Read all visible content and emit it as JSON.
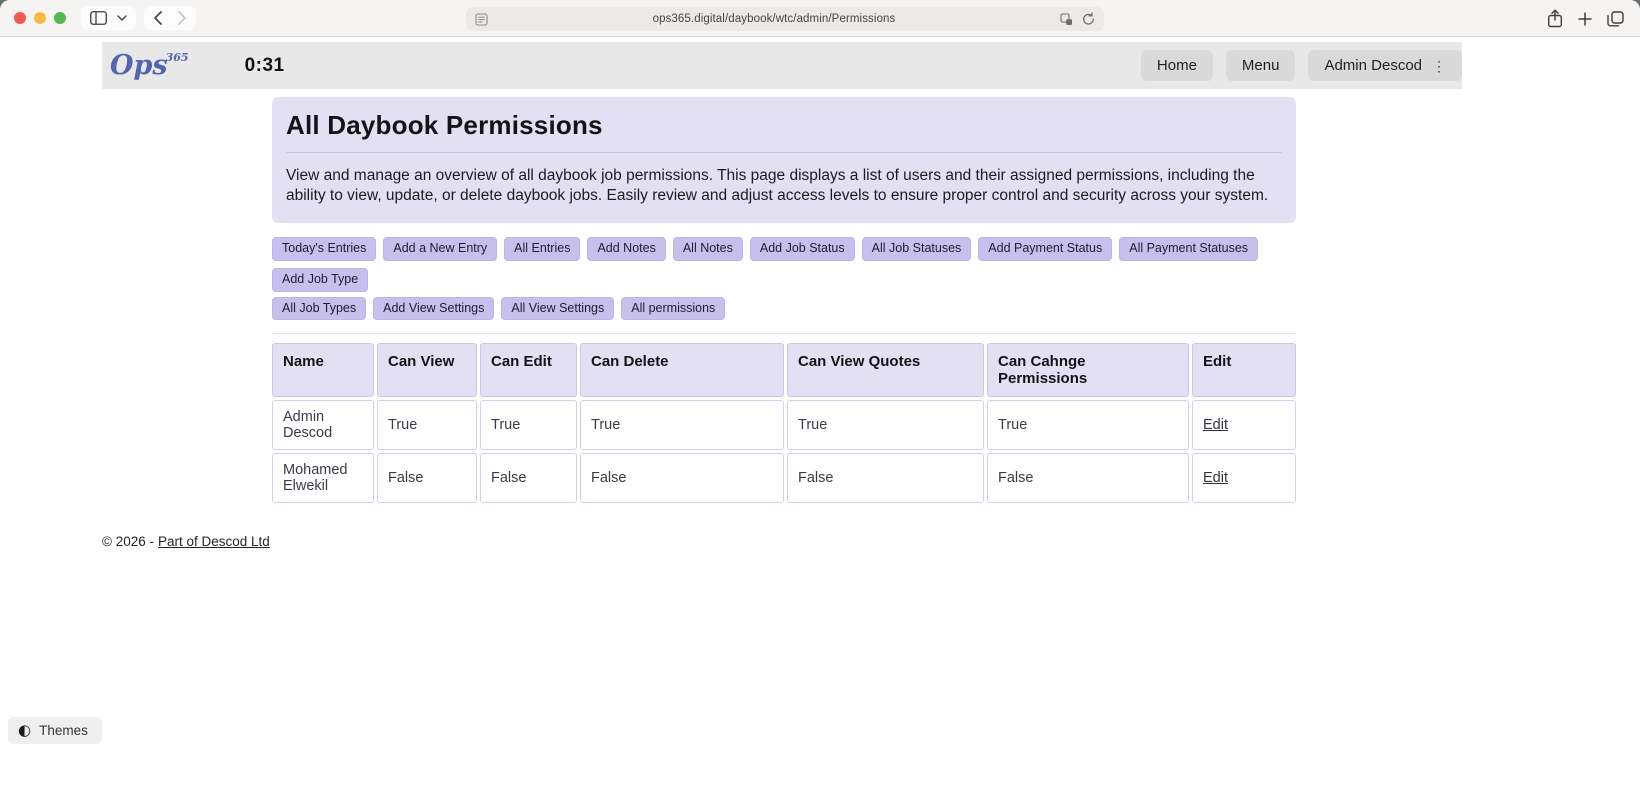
{
  "browser": {
    "url": "ops365.digital/daybook/wtc/admin/Permissions"
  },
  "site_header": {
    "logo_text": "Ops",
    "logo_superscript": "365",
    "timer": "0:31",
    "nav": [
      {
        "label": "Home"
      },
      {
        "label": "Menu"
      },
      {
        "label": "Admin Descod"
      }
    ]
  },
  "jumbotron": {
    "title": "All Daybook Permissions",
    "description": "View and manage an overview of all daybook job permissions. This page displays a list of users and their assigned permissions, including the ability to view, update, or delete daybook jobs. Easily review and adjust access levels to ensure proper control and security across your system."
  },
  "quick_links": {
    "row1": [
      "Today's Entries",
      "Add a New Entry",
      "All Entries",
      "Add Notes",
      "All Notes",
      "Add Job Status",
      "All Job Statuses",
      "Add Payment Status",
      "All Payment Statuses",
      "Add Job Type"
    ],
    "row2": [
      "All Job Types",
      "Add View Settings",
      "All View Settings",
      "All permissions"
    ]
  },
  "permissions_table": {
    "headers": [
      "Name",
      "Can View",
      "Can Edit",
      "Can Delete",
      "Can View Quotes",
      "Can Cahnge Permissions",
      "Edit"
    ],
    "rows": [
      {
        "name": "Admin Descod",
        "can_view": "True",
        "can_edit": "True",
        "can_delete": "True",
        "can_view_quotes": "True",
        "can_change_permissions": "True",
        "edit_label": "Edit"
      },
      {
        "name": "Mohamed Elwekil",
        "can_view": "False",
        "can_edit": "False",
        "can_delete": "False",
        "can_view_quotes": "False",
        "can_change_permissions": "False",
        "edit_label": "Edit"
      }
    ]
  },
  "footer": {
    "copyright_prefix": "© 2026 -",
    "link_label": "Part of Descod Ltd"
  },
  "themes": {
    "icon": "◐",
    "label": "Themes"
  },
  "colors": {
    "accent_lavender_panel": "#e3e0f4",
    "accent_lavender_pill": "#c7c0ed",
    "header_gray": "#e8e8e8",
    "logo_blue": "#5265ae"
  }
}
